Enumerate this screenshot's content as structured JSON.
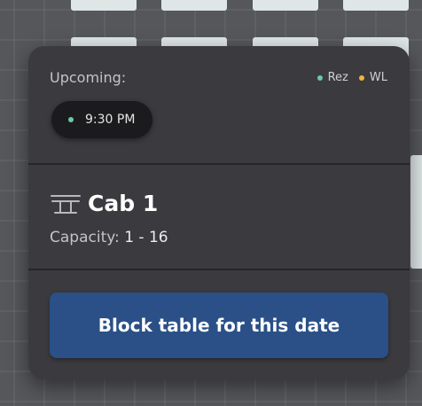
{
  "popover": {
    "upcoming_label": "Upcoming:",
    "legend": [
      {
        "label": "Rez",
        "color": "#6fc7a9"
      },
      {
        "label": "WL",
        "color": "#f0b63a"
      }
    ],
    "reservations": [
      {
        "time": "9:30 PM",
        "status_color": "#6fc7a9"
      }
    ],
    "table": {
      "icon": "table-icon",
      "name": "Cab 1",
      "capacity_label": "Capacity:",
      "capacity_value": "1 - 16"
    },
    "block_button_label": "Block table for this date"
  },
  "colors": {
    "popover_bg": "#3b3a3e",
    "button_bg": "#2a5087",
    "floor_bg": "#56575b",
    "floor_tiles": "#dfe6e6"
  }
}
